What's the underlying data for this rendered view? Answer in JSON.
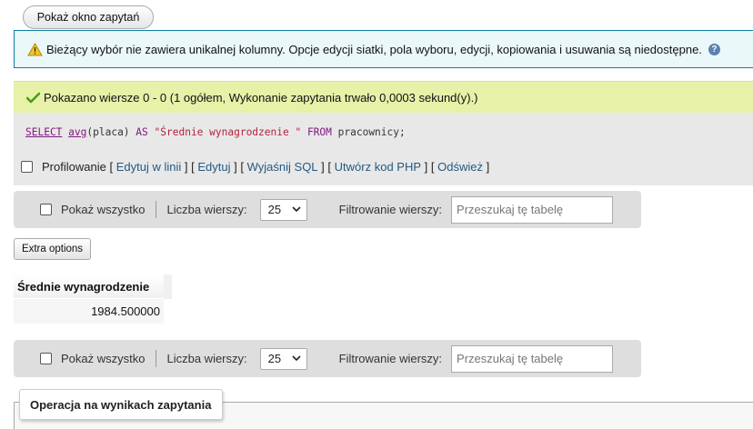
{
  "top": {
    "show_query_label": "Pokaż okno zapytań"
  },
  "notice": {
    "text": "Bieżący wybór nie zawiera unikalnej kolumny. Opcje edycji siatki, pola wyboru, edycji, kopiowania i usuwania są niedostępne.",
    "help_icon": "?"
  },
  "success": {
    "text": "Pokazano wiersze 0 - 0 (1 ogółem, Wykonanie zapytania trwało 0,0003 sekund(y).)"
  },
  "sql": {
    "select": "SELECT",
    "func": "avg",
    "args": "(placa)",
    "as": "AS",
    "alias": "\"Średnie wynagrodzenie \"",
    "from": "FROM",
    "table": "pracownicy;"
  },
  "query_tools": {
    "profiling": "Profilowanie",
    "open_br": "[",
    "close_br": "]",
    "inline_edit": "Edytuj w linii",
    "edit": "Edytuj",
    "explain": "Wyjaśnij SQL",
    "create_php": "Utwórz kod PHP",
    "refresh": "Odśwież"
  },
  "nav": {
    "show_all": "Pokaż wszystko",
    "rows_label": "Liczba wierszy:",
    "rows_value": "25",
    "filter_label": "Filtrowanie wierszy:",
    "filter_placeholder": "Przeszukaj tę tabelę"
  },
  "extra_options": "Extra options",
  "results": {
    "columns": [
      "Średnie wynagrodzenie"
    ],
    "rows": [
      [
        "1984.500000"
      ]
    ]
  },
  "operations_legend": "Operacja na wynikach zapytania",
  "colors": {
    "notice_bg": "#ebf8fa",
    "notice_border": "#0c7ea4",
    "success_bg": "#e7f1a8",
    "link": "#235a81",
    "sql_keyword": "#80197f",
    "sql_string": "#b3233b"
  },
  "icons": [
    "warning-icon",
    "help-icon",
    "success-check-icon",
    "chevron-down-icon"
  ]
}
